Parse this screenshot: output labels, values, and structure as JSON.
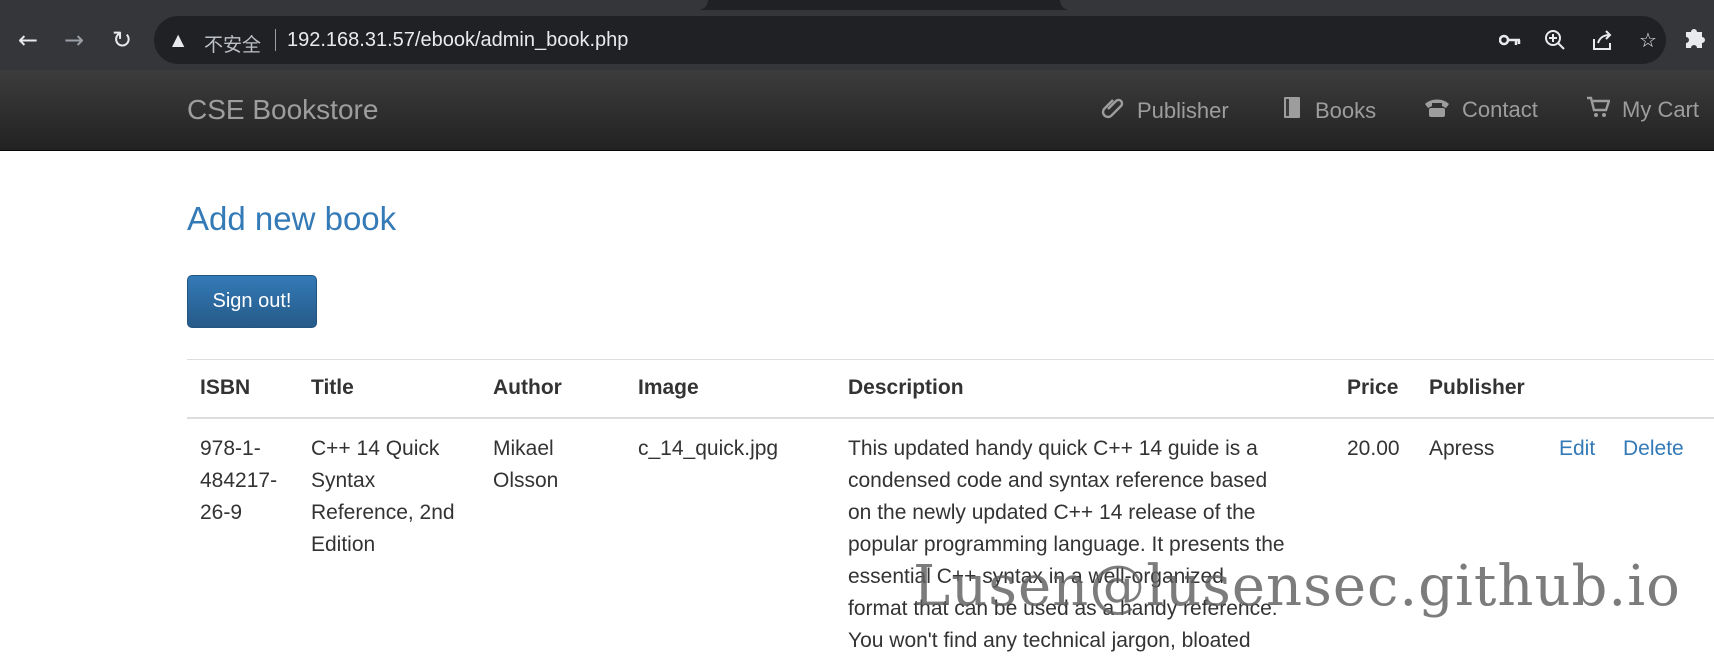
{
  "browser": {
    "nav": {
      "back_icon": "arrow-left-icon",
      "forward_icon": "arrow-right-icon",
      "reload_icon": "reload-icon"
    },
    "omnibox": {
      "security_icon": "warning-triangle-icon",
      "security_label": "不安全",
      "url": "192.168.31.57/ebook/admin_book.php"
    },
    "action_icons": [
      "key-icon",
      "zoom-icon",
      "share-icon",
      "star-icon",
      "puzzle-icon"
    ]
  },
  "navbar": {
    "brand": "CSE Bookstore",
    "links": [
      {
        "label": "Publisher",
        "icon": "paperclip-icon"
      },
      {
        "label": "Books",
        "icon": "book-icon"
      },
      {
        "label": "Contact",
        "icon": "phone-icon"
      },
      {
        "label": "My Cart",
        "icon": "cart-icon"
      }
    ]
  },
  "main": {
    "heading": "Add new book",
    "signout_label": "Sign out!",
    "table": {
      "headers": [
        "ISBN",
        "Title",
        "Author",
        "Image",
        "Description",
        "Price",
        "Publisher"
      ],
      "rows": [
        {
          "isbn_lines": [
            "978-1-",
            "484217-",
            "26-9"
          ],
          "title_lines": [
            "C++ 14 Quick",
            "Syntax",
            "Reference, 2nd",
            "Edition"
          ],
          "author_lines": [
            "Mikael",
            "Olsson"
          ],
          "image": "c_14_quick.jpg",
          "description_lines": [
            "This updated handy quick C++ 14 guide is a",
            "condensed code and syntax reference based",
            "on the newly updated C++ 14 release of the",
            "popular programming language. It presents the",
            "essential C++ syntax in a well-organized",
            "format that can be used as a handy reference.",
            "You won't find any technical jargon, bloated"
          ],
          "price": "20.00",
          "publisher": "Apress",
          "edit_label": "Edit",
          "delete_label": "Delete"
        }
      ]
    }
  },
  "watermark": "Lusen@lusensec.github.io"
}
